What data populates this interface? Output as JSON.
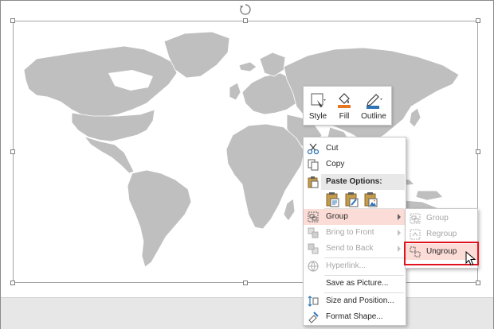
{
  "mini_toolbar": {
    "style_label": "Style",
    "fill_label": "Fill",
    "outline_label": "Outline"
  },
  "context_menu": {
    "cut": "Cut",
    "copy": "Copy",
    "paste_options_label": "Paste Options:",
    "group": "Group",
    "bring_to_front": "Bring to Front",
    "send_to_back": "Send to Back",
    "hyperlink": "Hyperlink...",
    "save_as_picture": "Save as Picture...",
    "size_and_position": "Size and Position...",
    "format_shape": "Format Shape..."
  },
  "group_submenu": {
    "group": "Group",
    "regroup": "Regroup",
    "ungroup": "Ungroup"
  },
  "colors": {
    "highlight": "#fcdcd6",
    "callout_border": "#e0141e",
    "map_fill": "#bfbfbf",
    "fill_accent": "#e87722",
    "outline_accent": "#2e75b6"
  }
}
